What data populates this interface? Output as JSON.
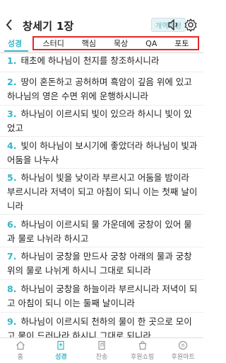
{
  "header": {
    "title": "창세기 1장",
    "version_button": "개역개정"
  },
  "tabs": {
    "main": "성경",
    "items": [
      "스터디",
      "핵심",
      "묵상",
      "QA",
      "포토"
    ]
  },
  "verses": [
    {
      "num": "1.",
      "text": "태초에 하나님이 천지를 창조하시니라"
    },
    {
      "num": "2.",
      "text": "땅이 혼돈하고 공허하며 흑암이 깊음 위에 있고 하나님의 영은 수면 위에 운행하시니라"
    },
    {
      "num": "3.",
      "text": "하나님이 이르시되 빛이 있으라 하시니 빛이 있었고"
    },
    {
      "num": "4.",
      "text": "빛이 하나님이 보시기에 좋았더라 하나님이 빛과 어둠을 나누사"
    },
    {
      "num": "5.",
      "text": "하나님이 빛을 낮이라 부르시고 어둠을 밤이라 부르시니라 저녁이 되고 아침이 되니 이는 첫째 날이니라"
    },
    {
      "num": "6.",
      "text": "하나님이 이르시되 물 가운데에 궁창이 있어 물과 물로 나뉘라 하시고"
    },
    {
      "num": "7.",
      "text": "하나님이 궁창을 만드사 궁창 아래의 물과 궁창 위의 물로 나뉘게 하시니 그대로 되니라"
    },
    {
      "num": "8.",
      "text": "하나님이 궁창을 하늘이라 부르시니라 저녁이 되고 아침이 되니 이는 둘째 날이니라"
    },
    {
      "num": "9.",
      "text": "하나님이 이르시되 천하의 물이 한 곳으로 모이고 뭍이 드러나라 하시니 그대로 되니라"
    }
  ],
  "bottom_nav": [
    {
      "label": "홈",
      "icon": "home-icon"
    },
    {
      "label": "성경",
      "icon": "bible-icon",
      "active": true
    },
    {
      "label": "찬송",
      "icon": "hymn-icon"
    },
    {
      "label": "후원쇼핑",
      "icon": "shopping-icon"
    },
    {
      "label": "후원마트",
      "icon": "mart-icon"
    }
  ],
  "colors": {
    "accent": "#33b6c9",
    "highlight_box": "#e5262a"
  }
}
